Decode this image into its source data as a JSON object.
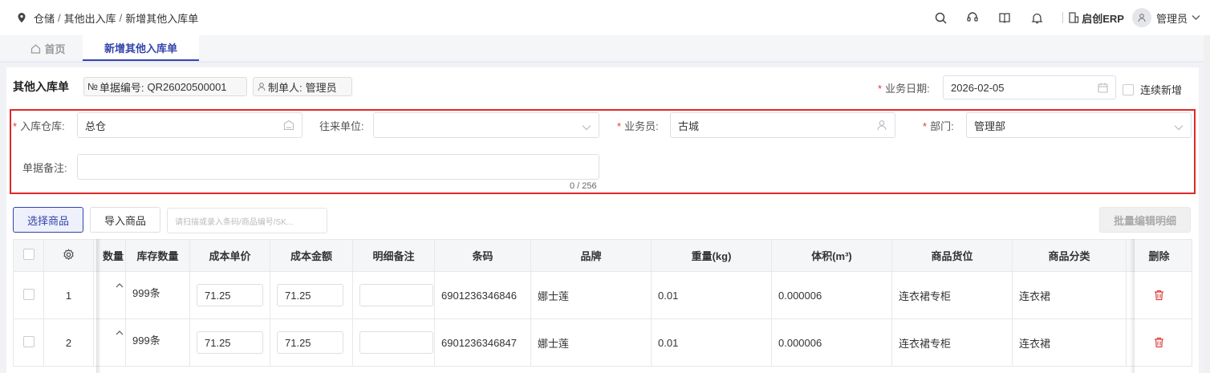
{
  "breadcrumb": [
    "仓储",
    "其他出入库",
    "新增其他入库单"
  ],
  "breadcrumb_sep": "/",
  "header": {
    "brand": "启创ERP",
    "user": "管理员"
  },
  "tabs": [
    {
      "label": "首页"
    },
    {
      "label": "新增其他入库单"
    }
  ],
  "form": {
    "title": "其他入库单",
    "doc_no_label": "单据编号:",
    "doc_no": "QR26020500001",
    "creator_label": "制单人:",
    "creator": "管理员",
    "date_label": "业务日期:",
    "date": "2026-02-05",
    "continue_label": "连续新增",
    "warehouse_label": "入库仓库:",
    "warehouse": "总仓",
    "partner_label": "往来单位:",
    "partner": "",
    "salesman_label": "业务员:",
    "salesman": "古城",
    "dept_label": "部门:",
    "dept": "管理部",
    "remark_label": "单据备注:",
    "remark": "",
    "remark_count": "0 / 256"
  },
  "toolbar": {
    "select_goods": "选择商品",
    "import_goods": "导入商品",
    "scan_placeholder": "请扫描或录入条码/商品编号/SK...",
    "batch_edit": "批量编辑明细"
  },
  "table": {
    "headers": [
      "",
      "",
      "数量",
      "库存数量",
      "成本单价",
      "成本金额",
      "明细备注",
      "条码",
      "品牌",
      "重量(kg)",
      "体积(m³)",
      "商品货位",
      "商品分类",
      "删除"
    ],
    "rows": [
      {
        "no": "1",
        "stock": "999条",
        "price": "71.25",
        "amount": "71.25",
        "note": "",
        "barcode": "6901236346846",
        "brand": "娜士莲",
        "weight": "0.01",
        "volume": "0.000006",
        "location": "连衣裙专柜",
        "category": "连衣裙"
      },
      {
        "no": "2",
        "stock": "999条",
        "price": "71.25",
        "amount": "71.25",
        "note": "",
        "barcode": "6901236346847",
        "brand": "娜士莲",
        "weight": "0.01",
        "volume": "0.000006",
        "location": "连衣裙专柜",
        "category": "连衣裙"
      }
    ]
  },
  "colors": {
    "primary": "#3344aa",
    "required": "#e33333",
    "highlight": "#e02828",
    "delete": "#e04040"
  }
}
